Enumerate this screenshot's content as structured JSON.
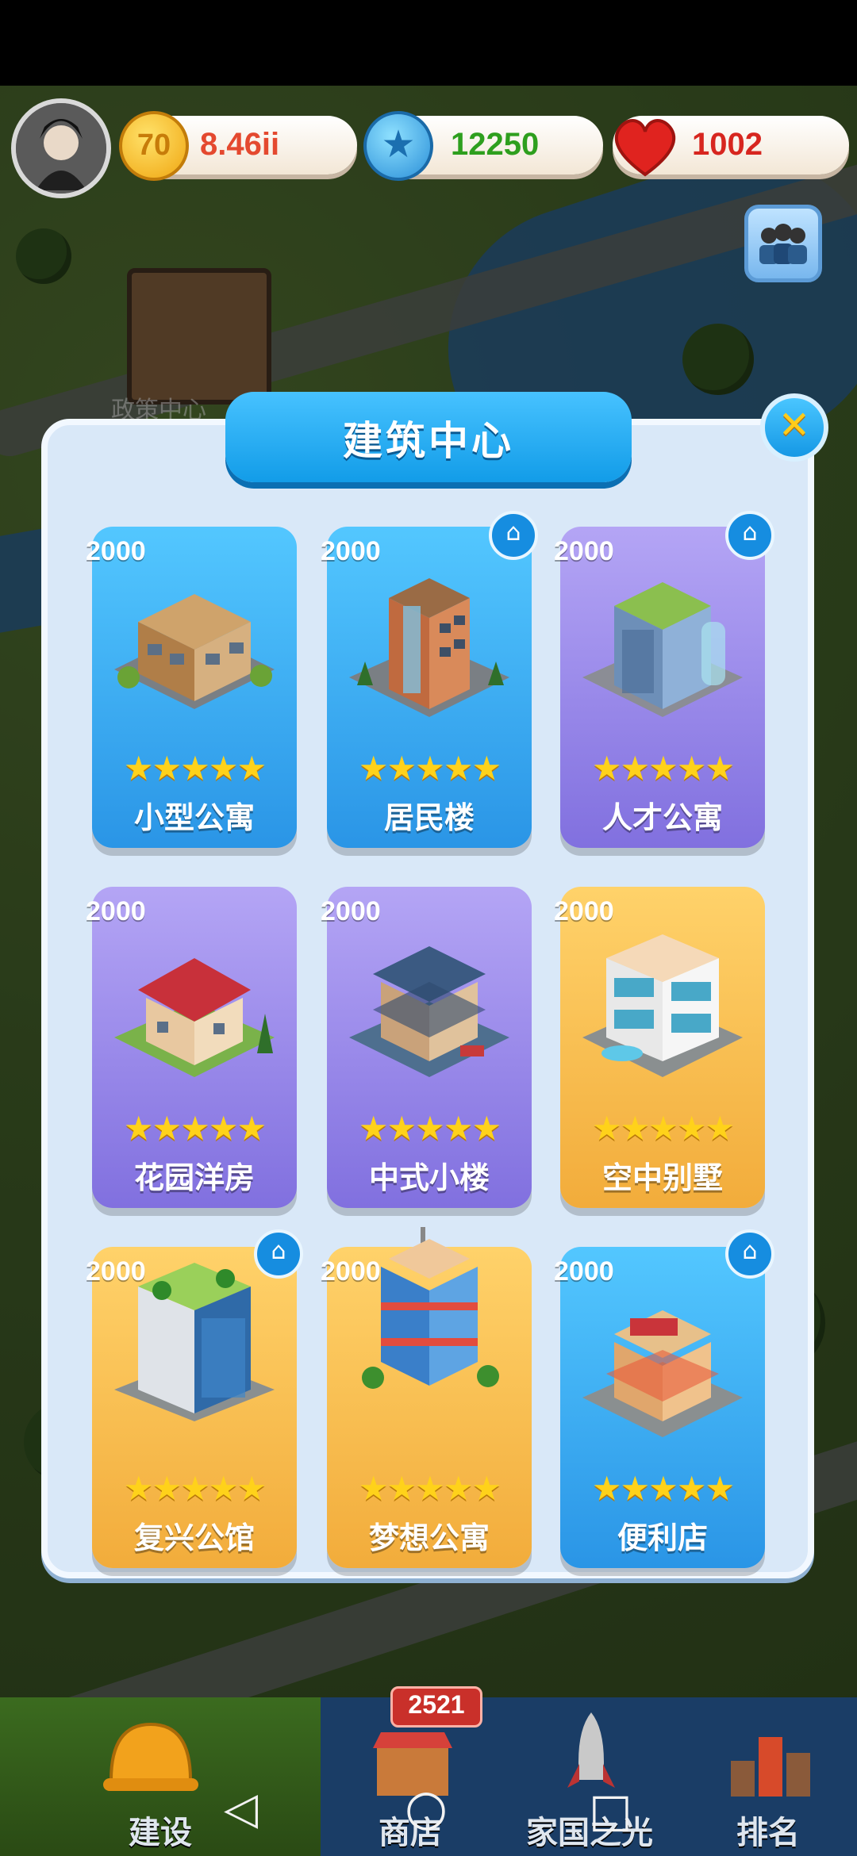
{
  "map": {
    "bg_label": "政策中心"
  },
  "top_bar": {
    "gold": {
      "value": "8.46ii",
      "color": "#e4492f",
      "icon": "gold-coin-icon"
    },
    "blue_coin": {
      "value": "12250",
      "color": "#2e9f1e",
      "icon": "blue-star-coin-icon"
    },
    "hearts": {
      "value": "1002",
      "color": "#d7261f",
      "icon": "heart-icon"
    }
  },
  "panel": {
    "title": "建筑中心",
    "cards": [
      {
        "price": "2000",
        "name": "小型公寓",
        "stars": "★★★★★",
        "style": "blue",
        "home": false
      },
      {
        "price": "2000",
        "name": "居民楼",
        "stars": "★★★★★",
        "style": "blue",
        "home": true
      },
      {
        "price": "2000",
        "name": "人才公寓",
        "stars": "★★★★★",
        "style": "purple",
        "home": true
      },
      {
        "price": "2000",
        "name": "花园洋房",
        "stars": "★★★★★",
        "style": "purple",
        "home": false
      },
      {
        "price": "2000",
        "name": "中式小楼",
        "stars": "★★★★★",
        "style": "purple",
        "home": false
      },
      {
        "price": "2000",
        "name": "空中别墅",
        "stars": "★★★★★",
        "style": "gold",
        "home": false
      },
      {
        "price": "2000",
        "name": "复兴公馆",
        "stars": "★★★★★",
        "style": "gold",
        "home": true
      },
      {
        "price": "2000",
        "name": "梦想公寓",
        "stars": "★★★★★",
        "style": "gold",
        "home": false
      },
      {
        "price": "2000",
        "name": "便利店",
        "stars": "★★★★★",
        "style": "blue",
        "home": true
      }
    ]
  },
  "bottom_nav": {
    "tabs": [
      {
        "label": "建设"
      },
      {
        "label": "商店"
      },
      {
        "label": "家国之光"
      },
      {
        "label": "排名"
      }
    ],
    "shop_badge": "2521"
  },
  "system_nav": {
    "back": "◁",
    "home": "○",
    "recents": "□"
  }
}
